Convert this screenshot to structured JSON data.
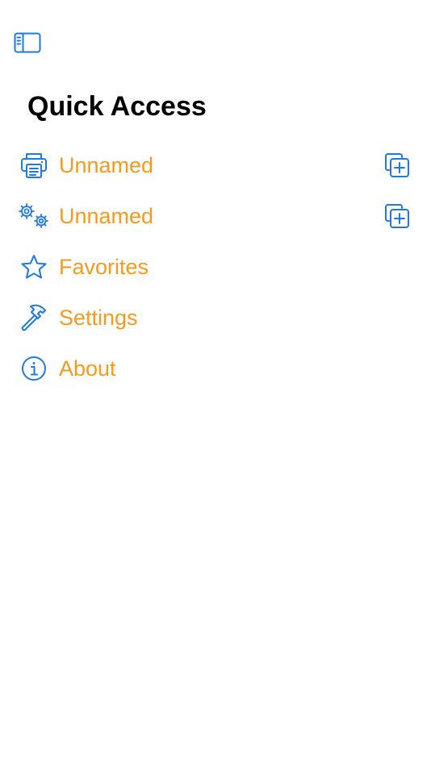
{
  "title": "Quick Access",
  "colors": {
    "accent_icon": "#1f7ae0",
    "label": "#f59a1b",
    "title": "#000000",
    "background": "#ffffff"
  },
  "toolbar": {
    "sidebar_icon": "sidebar-left-icon"
  },
  "menu": [
    {
      "label": "Unnamed",
      "icon": "printer-icon",
      "has_add": true
    },
    {
      "label": "Unnamed",
      "icon": "gears-icon",
      "has_add": true
    },
    {
      "label": "Favorites",
      "icon": "star-icon",
      "has_add": false
    },
    {
      "label": "Settings",
      "icon": "hammer-icon",
      "has_add": false
    },
    {
      "label": "About",
      "icon": "info-icon",
      "has_add": false
    }
  ]
}
